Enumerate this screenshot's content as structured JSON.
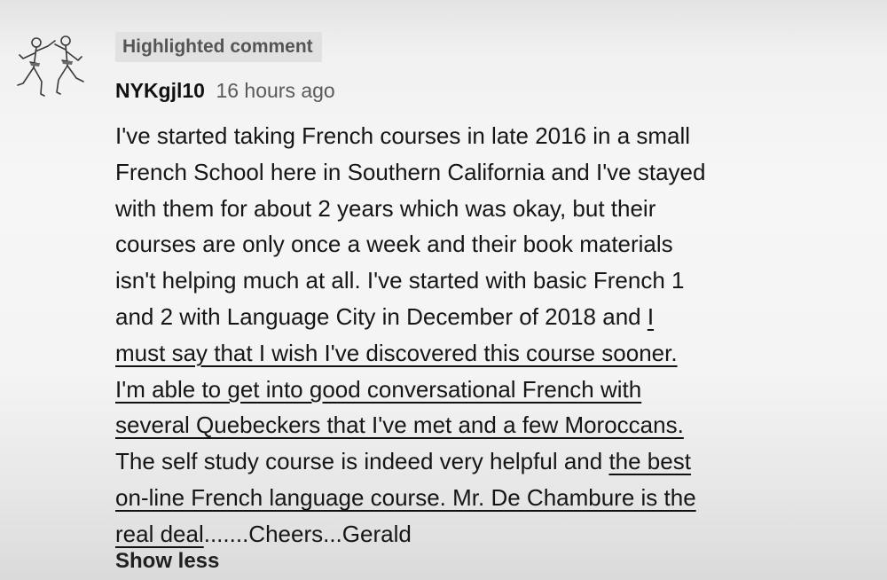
{
  "comment": {
    "badge": "Highlighted comment",
    "author": "NYKgjl10",
    "timestamp": "16 hours ago",
    "avatar_icon": "karate-fighters-icon",
    "lines": [
      {
        "text": "I've started taking French courses in late 2016 in a small"
      },
      {
        "text": "French School here in Southern California and I've stayed"
      },
      {
        "text": "with them for about 2 years which was okay, but their"
      },
      {
        "text": "courses are only once a week and their book materials"
      },
      {
        "text": "isn't helping much at all. I've started with basic French 1"
      },
      {
        "text": "and 2 with Language City in December of 2018 and ",
        "mark": "I"
      },
      {
        "mark": "must say that I wish I've discovered this course sooner."
      },
      {
        "mark": "I'm able to get into good conversational French with"
      },
      {
        "mark": "several Quebeckers that I've met and a few Moroccans."
      },
      {
        "text": "The self study course is indeed very helpful and ",
        "mark": "the best"
      },
      {
        "mark": "on-line French language course. Mr. De Chambure is the"
      },
      {
        "mark": "real deal",
        "tail": ".......Cheers...Gerald"
      }
    ],
    "show_less": "Show less"
  }
}
